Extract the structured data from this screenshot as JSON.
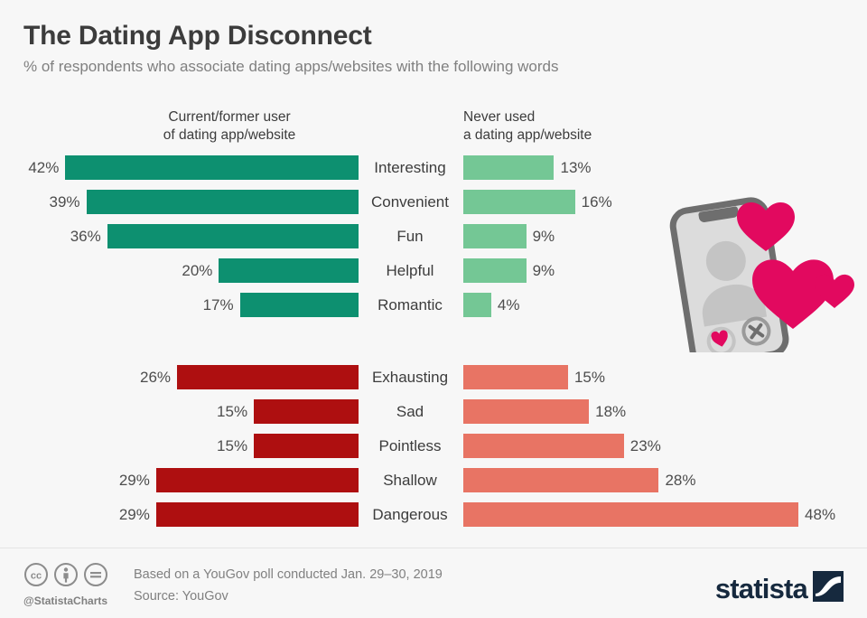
{
  "header": {
    "title": "The Dating App Disconnect",
    "subtitle": "% of respondents who associate dating apps/websites with the following words"
  },
  "columns": {
    "left": {
      "line1": "Current/former user",
      "line2": "of dating app/website"
    },
    "right": {
      "line1": "Never used",
      "line2": "a dating app/website"
    }
  },
  "footer": {
    "handle": "@StatistaCharts",
    "note": "Based on a YouGov poll conducted Jan. 29–30, 2019",
    "source": "Source: YouGov",
    "logo": "statista",
    "cc_icons": [
      "cc-icon",
      "cc-attribution-icon",
      "cc-noderivatives-icon"
    ]
  },
  "illustration": {
    "name": "dating-app-phone-hearts-illustration",
    "phone_outline_color": "#6e6e6e",
    "phone_screen_color": "#dcdcdc",
    "avatar_color": "#c4c4c4",
    "heart_color": "#e2095f",
    "like_button": "heart-icon",
    "dislike_button": "x-icon"
  },
  "colors": {
    "background": "#f7f7f7",
    "positive_user": "#0d9070",
    "positive_nonuser": "#74c795",
    "negative_user": "#ae0f10",
    "negative_nonuser": "#e87464",
    "title": "#3c3c3c",
    "subtitle": "#808080",
    "logo": "#16293e"
  },
  "chart_data": {
    "type": "bar",
    "title": "The Dating App Disconnect",
    "subtitle": "% of respondents who associate dating apps/websites with the following words",
    "xlabel": "",
    "ylabel": "",
    "orientation": "horizontal-diverging",
    "unit": "%",
    "xlim": [
      0,
      48
    ],
    "grid": false,
    "legend_position": "top",
    "series": [
      {
        "name": "Current/former user of dating app/website",
        "side": "left"
      },
      {
        "name": "Never used a dating app/website",
        "side": "right"
      }
    ],
    "groups": [
      {
        "name": "positive",
        "left_color": "#0d9070",
        "right_color": "#74c795",
        "rows": [
          {
            "label": "Interesting",
            "left": 42,
            "right": 13,
            "left_text": "42%",
            "right_text": "13%"
          },
          {
            "label": "Convenient",
            "left": 39,
            "right": 16,
            "left_text": "39%",
            "right_text": "16%"
          },
          {
            "label": "Fun",
            "left": 36,
            "right": 9,
            "left_text": "36%",
            "right_text": "9%"
          },
          {
            "label": "Helpful",
            "left": 20,
            "right": 9,
            "left_text": "20%",
            "right_text": "9%"
          },
          {
            "label": "Romantic",
            "left": 17,
            "right": 4,
            "left_text": "17%",
            "right_text": "4%"
          }
        ]
      },
      {
        "name": "negative",
        "left_color": "#ae0f10",
        "right_color": "#e87464",
        "rows": [
          {
            "label": "Exhausting",
            "left": 26,
            "right": 15,
            "left_text": "26%",
            "right_text": "15%"
          },
          {
            "label": "Sad",
            "left": 15,
            "right": 18,
            "left_text": "15%",
            "right_text": "18%"
          },
          {
            "label": "Pointless",
            "left": 15,
            "right": 23,
            "left_text": "15%",
            "right_text": "23%"
          },
          {
            "label": "Shallow",
            "left": 29,
            "right": 28,
            "left_text": "29%",
            "right_text": "28%"
          },
          {
            "label": "Dangerous",
            "left": 29,
            "right": 48,
            "left_text": "29%",
            "right_text": "48%"
          }
        ]
      }
    ]
  }
}
